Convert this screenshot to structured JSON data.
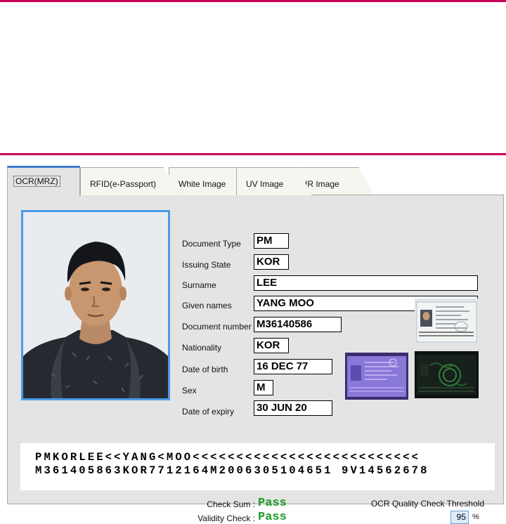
{
  "tabs": [
    {
      "label": "OCR(MRZ)",
      "active": true
    },
    {
      "label": "RFID(e-Passport)",
      "active": false
    },
    {
      "label": "White Image",
      "active": false
    },
    {
      "label": "UV Image",
      "active": false
    },
    {
      "label": "IR Image",
      "active": false
    }
  ],
  "fields": {
    "document_type": {
      "label": "Document Type",
      "value": "PM"
    },
    "issuing_state": {
      "label": "Issuing State",
      "value": "KOR"
    },
    "surname": {
      "label": "Surname",
      "value": "LEE"
    },
    "given_names": {
      "label": "Given names",
      "value": "YANG MOO"
    },
    "document_number": {
      "label": "Document number",
      "value": "M36140586"
    },
    "nationality": {
      "label": "Nationality",
      "value": "KOR"
    },
    "date_of_birth": {
      "label": "Date of birth",
      "value": "16 DEC 77"
    },
    "sex": {
      "label": "Sex",
      "value": "M"
    },
    "date_of_expiry": {
      "label": "Date of expiry",
      "value": "30 JUN 20"
    }
  },
  "mrz": {
    "line1": "PMKORLEE<<YANG<MOO<<<<<<<<<<<<<<<<<<<<<<<<<<",
    "line2": "M361405863KOR7712164M2006305104651 9V14562678"
  },
  "status": {
    "check_sum_label": "Check Sum :",
    "check_sum_value": "Pass",
    "validity_label": "Validity Check :",
    "validity_value": "Pass",
    "threshold_label": "OCR Quality Check Threshold",
    "threshold_value": "95",
    "threshold_unit": "%"
  },
  "colors": {
    "accent_rule": "#c8005a",
    "pass_green": "#1e9b28",
    "photo_border": "#4b9be8"
  }
}
